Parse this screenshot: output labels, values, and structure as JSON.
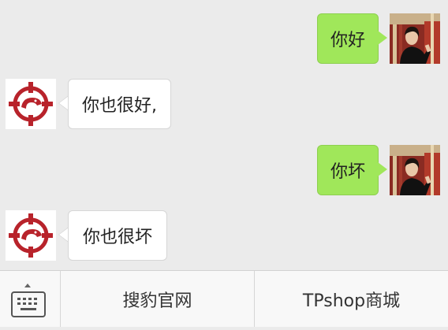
{
  "messages": [
    {
      "direction": "outgoing",
      "text": "你好",
      "avatar": "user-photo-avatar"
    },
    {
      "direction": "incoming",
      "text": "你也很好,",
      "avatar": "brand-logo-avatar"
    },
    {
      "direction": "outgoing",
      "text": "你坏",
      "avatar": "user-photo-avatar"
    },
    {
      "direction": "incoming",
      "text": "你也很坏",
      "avatar": "brand-logo-avatar"
    }
  ],
  "bottom_menu": {
    "keyboard_icon": "keyboard-toggle-icon",
    "items": [
      {
        "label": "搜豹官网"
      },
      {
        "label": "TPshop商城"
      }
    ]
  },
  "colors": {
    "background": "#ebebeb",
    "outgoing_bubble": "#a0e75a",
    "incoming_bubble": "#ffffff",
    "brand_red": "#b8232b"
  }
}
